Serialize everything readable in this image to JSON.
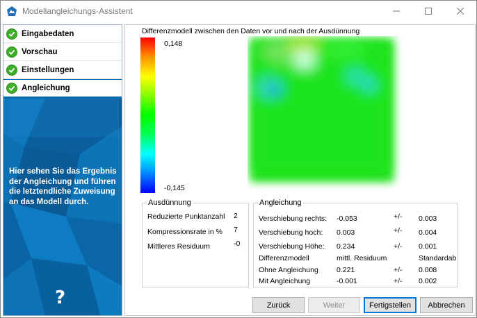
{
  "window": {
    "title": "Modellangleichungs-Assistent",
    "icons": {
      "app": "terrain-logo-icon",
      "minimize": "minimize-icon",
      "maximize": "maximize-icon",
      "close": "close-icon"
    }
  },
  "nav": {
    "items": [
      {
        "label": "Eingabedaten",
        "done": true
      },
      {
        "label": "Vorschau",
        "done": true
      },
      {
        "label": "Einstellungen",
        "done": true
      },
      {
        "label": "Angleichung",
        "done": true,
        "active": true
      }
    ],
    "description": "Hier sehen Sie das Ergebnis der Angleichung und führen die letztendliche Zuweisung an das Modell durch.",
    "help": "?"
  },
  "diff": {
    "title": "Differenzmodell zwischen den Daten vor und nach der Ausdünnung",
    "scale_max": "0,148",
    "scale_min": "-0,145"
  },
  "ausduennung": {
    "title": "Ausdünnung",
    "rows": [
      {
        "label": "Reduzierte Punktanzahl",
        "value": "2"
      },
      {
        "label": "Kompressionsrate in %",
        "value": "7"
      },
      {
        "label": "Mittleres Residuum",
        "value": "-0"
      }
    ]
  },
  "angleichung": {
    "title": "Angleichung",
    "pm": "+/-",
    "rows": [
      {
        "label": "Verschiebung rechts:",
        "value": "-0.053",
        "pm": "+/-",
        "err": "0.003"
      },
      {
        "label": "Verschiebung hoch:",
        "value": "0.003",
        "pm": "+/-",
        "err": "0.004"
      },
      {
        "label": "Verschiebung Höhe:",
        "value": "0.234",
        "pm": "+/-",
        "err": "0.001"
      }
    ],
    "table_header": {
      "label": "Differenzmodell",
      "col1": "mittl. Residuum",
      "col2": "Standardab"
    },
    "table_rows": [
      {
        "label": "Ohne Angleichung",
        "value": "0.221",
        "pm": "+/-",
        "err": "0.008"
      },
      {
        "label": "Mit Angleichung",
        "value": "-0.001",
        "pm": "+/-",
        "err": "0.002"
      }
    ]
  },
  "buttons": {
    "back": "Zurück",
    "next": "Weiter",
    "finish": "Fertigstellen",
    "cancel": "Abbrechen"
  }
}
